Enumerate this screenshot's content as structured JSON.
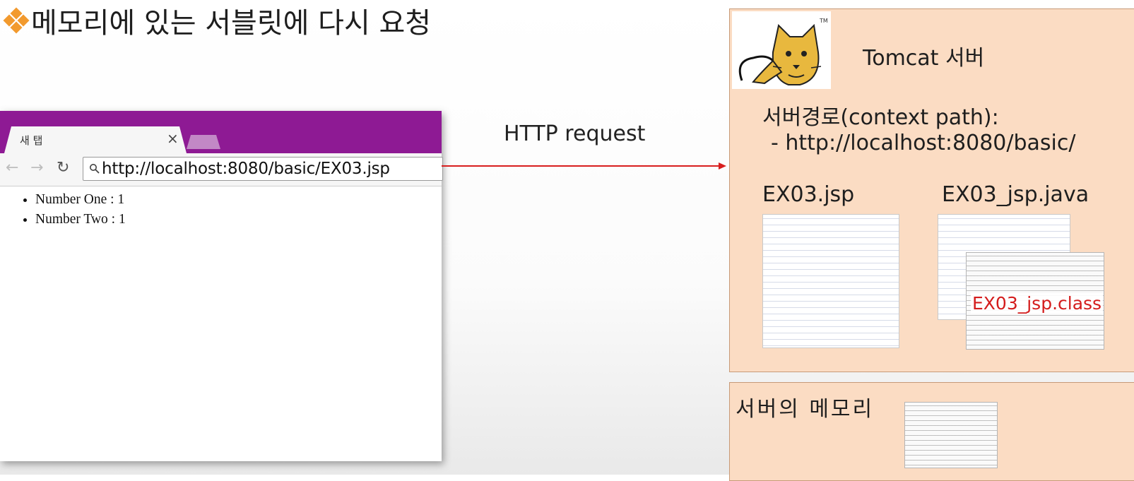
{
  "slide": {
    "title": "메모리에 있는 서블릿에 다시 요청",
    "bullet_icon": "diamond-bullet-icon",
    "accent_color": "#f29a2e"
  },
  "browser": {
    "tab_title": "새 탭",
    "tab_close": "×",
    "url": "http://localhost:8080/basic/EX03.jsp",
    "tab_bar_color": "#8e1a94",
    "page_items": [
      "Number One : 1",
      "Number Two : 1"
    ]
  },
  "arrow": {
    "label": "HTTP request",
    "color": "#d81e1e"
  },
  "server": {
    "title": "Tomcat 서버",
    "logo_tm": "TM",
    "context_path_label": "서버경로(context path):",
    "context_path_value": "- http://localhost:8080/basic/",
    "jsp_file": "EX03.jsp",
    "java_file": "EX03_jsp.java",
    "class_file": "EX03_jsp.class",
    "box_color": "#fbdcc3"
  },
  "memory": {
    "label": "서버의 메모리"
  }
}
